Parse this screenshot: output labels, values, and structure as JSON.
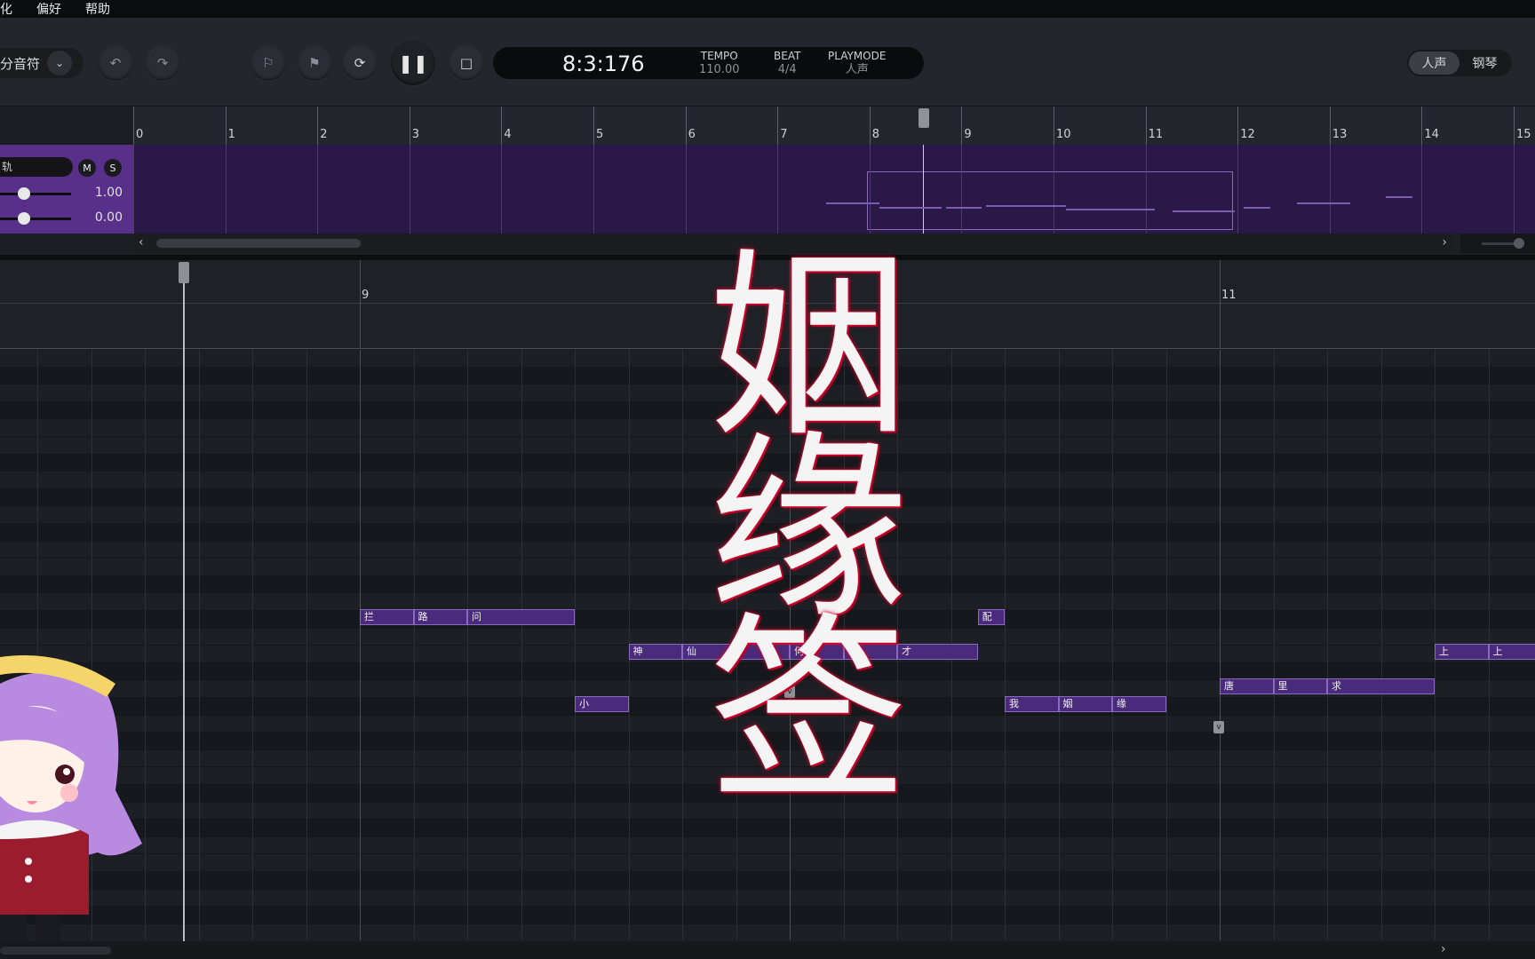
{
  "menu": {
    "items": [
      "化",
      "偏好",
      "帮助"
    ]
  },
  "toolbar": {
    "snap_label": "分音符",
    "position": "8:3:176",
    "tempo_label": "TEMPO",
    "tempo_value": "110.00",
    "beat_label": "BEAT",
    "beat_value": "4/4",
    "playmode_label": "PLAYMODE",
    "playmode_value": "人声",
    "mode_voice": "人声",
    "mode_piano": "钢琴"
  },
  "track": {
    "name": "轨",
    "mute": "M",
    "solo": "S",
    "volume": "1.00",
    "pan": "0.00",
    "volume_level": 0.25,
    "pan_level": 0.25
  },
  "overview_ruler": [
    "0",
    "1",
    "2",
    "3",
    "4",
    "5",
    "6",
    "7",
    "8",
    "9",
    "10",
    "11",
    "12",
    "13",
    "14",
    "15"
  ],
  "roll_ruler": [
    "9",
    "10",
    "11"
  ],
  "title_art": "姻缘签",
  "notes": [
    {
      "lyric": "拦",
      "lane": 15,
      "start": 0,
      "len": 1
    },
    {
      "lyric": "路",
      "lane": 15,
      "start": 1,
      "len": 1
    },
    {
      "lyric": "问",
      "lane": 15,
      "start": 2,
      "len": 2
    },
    {
      "lyric": "配",
      "lane": 15,
      "start": 11.5,
      "len": 0.5
    },
    {
      "lyric": "神",
      "lane": 17,
      "start": 5,
      "len": 1
    },
    {
      "lyric": "仙",
      "lane": 17,
      "start": 6,
      "len": 2
    },
    {
      "lyric": "何",
      "lane": 17,
      "start": 8,
      "len": 1
    },
    {
      "lyric": "时",
      "lane": 17,
      "start": 9,
      "len": 1
    },
    {
      "lyric": "才",
      "lane": 17,
      "start": 10,
      "len": 1.5
    },
    {
      "lyric": "上",
      "lane": 17,
      "start": 20,
      "len": 1
    },
    {
      "lyric": "上",
      "lane": 17,
      "start": 21,
      "len": 1
    },
    {
      "lyric": "唐",
      "lane": 19,
      "start": 16,
      "len": 1
    },
    {
      "lyric": "里",
      "lane": 19,
      "start": 17,
      "len": 1
    },
    {
      "lyric": "求",
      "lane": 19,
      "start": 18,
      "len": 2
    },
    {
      "lyric": "小",
      "lane": 20,
      "start": 4,
      "len": 1
    },
    {
      "lyric": "我",
      "lane": 20,
      "start": 12,
      "len": 1
    },
    {
      "lyric": "姻",
      "lane": 20,
      "start": 13,
      "len": 1
    },
    {
      "lyric": "缘",
      "lane": 20,
      "start": 14,
      "len": 1
    }
  ],
  "colors": {
    "note_fill": "#4a2a7a",
    "note_border": "#8a6ac0",
    "track_purple": "#58308a",
    "title_glow": "#d0002a"
  }
}
